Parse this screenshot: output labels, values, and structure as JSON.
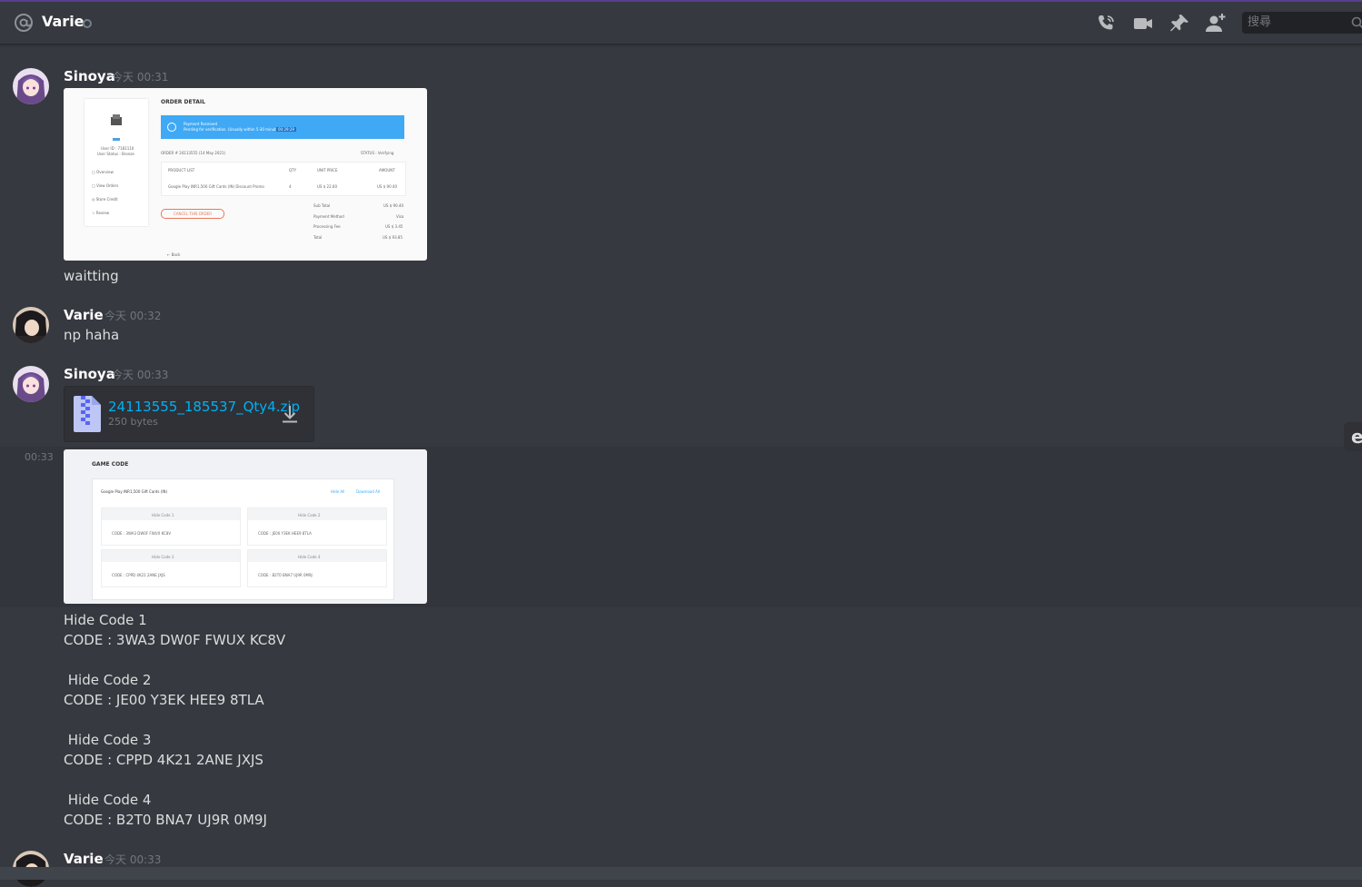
{
  "header": {
    "channel_name": "Varie",
    "search_placeholder": "搜尋",
    "icons": [
      "at-icon",
      "status-dot",
      "call-icon",
      "video-icon",
      "pin-icon",
      "add-friend-icon",
      "search-icon"
    ]
  },
  "messages": [
    {
      "author": "Sinoya",
      "timestamp": "今天 00:31",
      "image": {
        "heading": "ORDER DETAIL",
        "banner_title": "Payment Received",
        "banner_sub": "Pending for verification. (Usually within 5-30 minutes)",
        "banner_timer": "00:29:29",
        "user_id": "User ID : 7181110",
        "user_status": "User Status : Bronze",
        "menu": [
          "Overview",
          "View Orders",
          "Store Credit",
          "Review"
        ],
        "order_no": "ORDER # 24113555 (14 May 2021)",
        "status": "STATUS : Verifying",
        "columns": [
          "PRODUCT LIST",
          "QTY",
          "UNIT PRICE",
          "AMOUNT"
        ],
        "row": [
          "Google Play INR1,500 Gift Cards (IN) Discount Promo",
          "4",
          "US $ 22.60",
          "US $ 90.40"
        ],
        "cancel": "CANCEL THIS ORDER",
        "summary": [
          [
            "Sub Total",
            "US $ 90.40"
          ],
          [
            "Payment Method",
            "Visa"
          ],
          [
            "Processing Fee",
            "US $ 3.45"
          ],
          [
            "Total",
            "US $ 93.85"
          ]
        ],
        "back": "← Back"
      },
      "text": "waitting"
    },
    {
      "author": "Varie",
      "timestamp": "今天 00:32",
      "text": "np haha"
    },
    {
      "author": "Sinoya",
      "timestamp": "今天 00:33",
      "attachment": {
        "filename": "24113555_185537_Qty4.zip",
        "size": "250 bytes"
      },
      "followup_timestamp": "00:33",
      "image": {
        "heading": "GAME CODE",
        "product": "Google Play INR1,500 Gift Cards (IN)",
        "hide_all": "Hide All",
        "download_all": "Download All",
        "codes": [
          {
            "label": "Hide Code 1",
            "code": "CODE : 3WA3 DW0F FWUX KC8V"
          },
          {
            "label": "Hide Code 2",
            "code": "CODE : JE00 Y3EK HEE9 8TLA"
          },
          {
            "label": "Hide Code 3",
            "code": "CODE : CPPD 4K21 2ANE JXJS"
          },
          {
            "label": "Hide Code 4",
            "code": "CODE : B2T0 BNA7 UJ9R 0M9J"
          }
        ]
      },
      "text_lines": [
        "Hide Code 1",
        "CODE : 3WA3 DW0F FWUX KC8V",
        " Hide Code 2",
        "CODE : JE00 Y3EK HEE9 8TLA",
        " Hide Code 3",
        "CODE : CPPD 4K21 2ANE JXJS",
        " Hide Code 4",
        "CODE : B2T0 BNA7 UJ9R 0M9J"
      ]
    },
    {
      "author": "Varie",
      "timestamp": "今天 00:33"
    }
  ],
  "colors": {
    "background": "#36393f",
    "link": "#00b0f4",
    "accent_bar": "#5b3f93",
    "banner": "#3fa9f5"
  }
}
